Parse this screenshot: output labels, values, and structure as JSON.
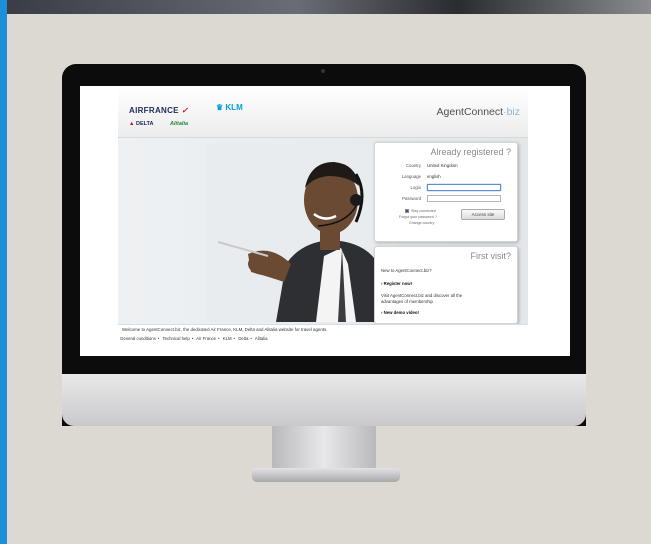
{
  "header": {
    "airfrance": "AIRFRANCE",
    "klm": "KLM",
    "delta": "DELTA",
    "alitalia": "Alitalia",
    "brand_main": "AgentConnect",
    "brand_suffix": "·biz"
  },
  "login": {
    "title": "Already registered ?",
    "country_label": "Country",
    "country_value": "United Kingdom",
    "language_label": "Language",
    "language_value": "english",
    "login_label": "Login",
    "login_value": "",
    "password_label": "Password",
    "password_value": "",
    "stay_connected": "Stay connected",
    "forgot_password": "Forgot your password ?",
    "change_country": "Change country",
    "access_button": "Access site"
  },
  "first_visit": {
    "title": "First visit?",
    "question": "New to AgentConnect.biz?",
    "register": "› Register now!",
    "visit_text_1": "Visit AgentConnect.biz and discover all the",
    "visit_text_2": "advantages of membership",
    "demo": "› New demo video!"
  },
  "welcome_text": "Welcome to AgentConnect.biz, the dedicated Air France, KLM, Delta and Alitalia website for travel agents.",
  "footer": {
    "links": [
      "General conditions",
      "Technical help",
      "Air France",
      "KLM",
      "Delta",
      "Alitalia"
    ]
  },
  "colors": {
    "accent_blue": "#1d8fd8",
    "airfrance_red": "#c8102e",
    "klm_blue": "#00a1de"
  }
}
